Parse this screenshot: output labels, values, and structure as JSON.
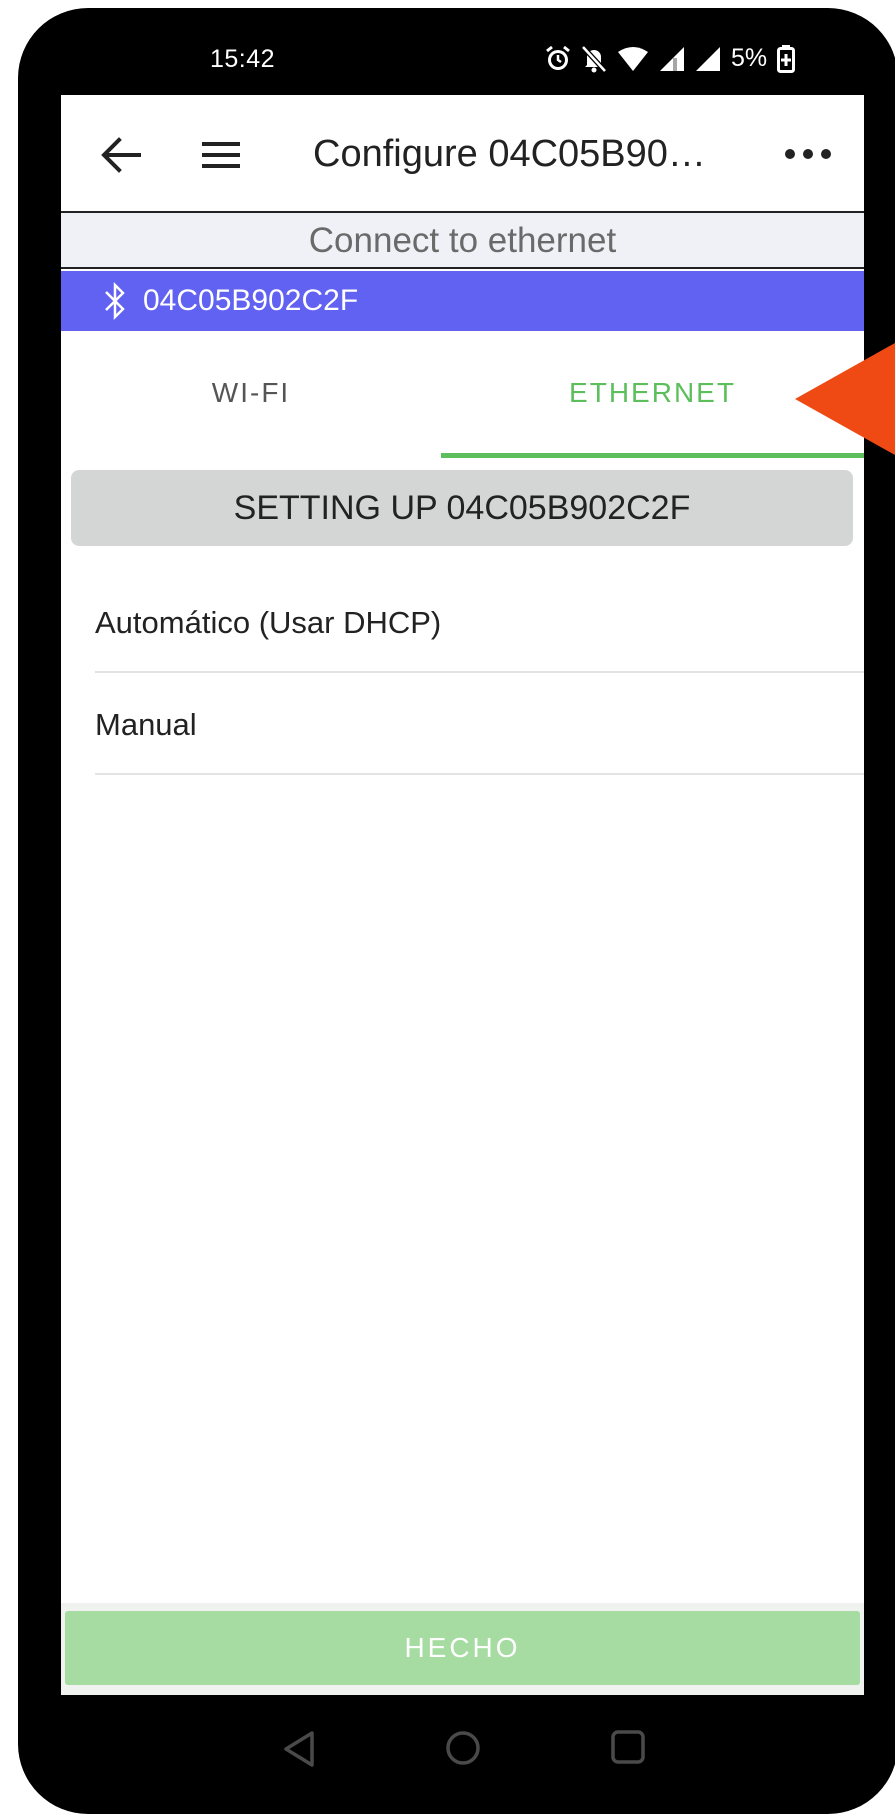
{
  "status_bar": {
    "time": "15:42",
    "battery_text": "5%",
    "icons": [
      "alarm-icon",
      "bell-off-icon",
      "wifi-icon",
      "signal-icon",
      "signal-icon",
      "battery-charging-icon"
    ]
  },
  "app_bar": {
    "title": "Configure 04C05B90…",
    "back_icon": "arrow-left-icon",
    "menu_icon": "hamburger-icon",
    "more_icon": "more-horizontal-icon"
  },
  "subheader": "Connect to ethernet",
  "device": {
    "icon": "bluetooth-icon",
    "id": "04C05B902C2F"
  },
  "tabs": [
    {
      "label": "WI-FI",
      "active": false
    },
    {
      "label": "ETHERNET",
      "active": true
    }
  ],
  "setup_banner": "SETTING UP 04C05B902C2F",
  "options": [
    {
      "label": "Automático (Usar DHCP)"
    },
    {
      "label": "Manual"
    }
  ],
  "done_button": "HECHO",
  "colors": {
    "accent_green": "#5cbf5c",
    "device_bar": "#6161f2",
    "done_button": "#a6dca2",
    "annotation_arrow": "#f04a14"
  }
}
